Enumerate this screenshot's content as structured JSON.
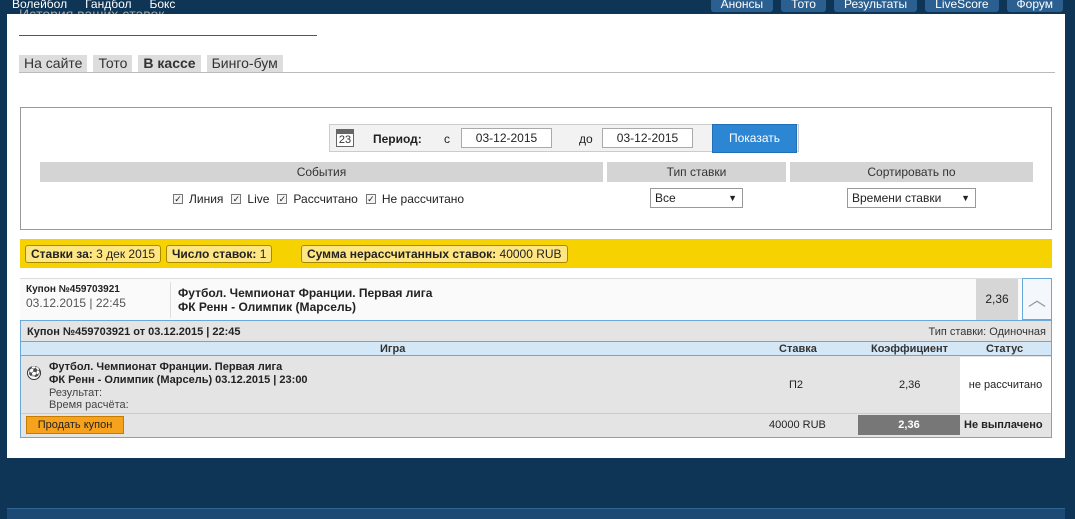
{
  "topnav": {
    "left": [
      "Волейбол",
      "Гандбол",
      "Бокс"
    ],
    "right": [
      "Анонсы",
      "Тото",
      "Результаты",
      "LiveScore",
      "Форум"
    ]
  },
  "page_title": "История ваших ставок",
  "tabs": [
    "На сайте",
    "Тото",
    "В кассе",
    "Бинго-бум"
  ],
  "filter": {
    "calendar_day": "23",
    "period_label": "Период:",
    "from_label": "с",
    "from_date": "03-12-2015",
    "to_label": "до",
    "to_date": "03-12-2015",
    "show_button": "Показать",
    "events_header": "События",
    "bet_type_header": "Тип ставки",
    "sort_header": "Сортировать по",
    "checks": [
      "Линия",
      "Live",
      "Рассчитано",
      "Не рассчитано"
    ],
    "bet_type_value": "Все",
    "sort_value": "Времени ставки"
  },
  "summary": {
    "bets_for_label": "Ставки за:",
    "bets_for_value": "3 дек 2015",
    "count_label": "Число ставок:",
    "count_value": "1",
    "sum_label": "Сумма нерассчитанных ставок:",
    "sum_value": "40000 RUB"
  },
  "coupon": {
    "id": "Купон №459703921",
    "datetime": "03.12.2015 | 22:45",
    "event_line1": "Футбол. Чемпионат Франции. Первая лига",
    "event_line2": "ФК Ренн - Олимпик (Марсель)",
    "odds": "2,36"
  },
  "detail": {
    "title": "Купон №459703921 от 03.12.2015 | 22:45",
    "bet_type": "Тип ставки: Одиночная",
    "columns": [
      "Игра",
      "Ставка",
      "Коэффициент",
      "Статус"
    ],
    "game_line1": "Футбол. Чемпионат Франции. Первая лига",
    "game_line2": "ФК Ренн - Олимпик (Марсель) 03.12.2015 | 23:00",
    "result_label": "Результат:",
    "calc_time_label": "Время расчёта:",
    "stake": "П2",
    "odds": "2,36",
    "status": "не рассчитано",
    "sell_button": "Продать купон",
    "total_stake": "40000 RUB",
    "total_odds": "2,36",
    "payout_status": "Не выплачено"
  }
}
